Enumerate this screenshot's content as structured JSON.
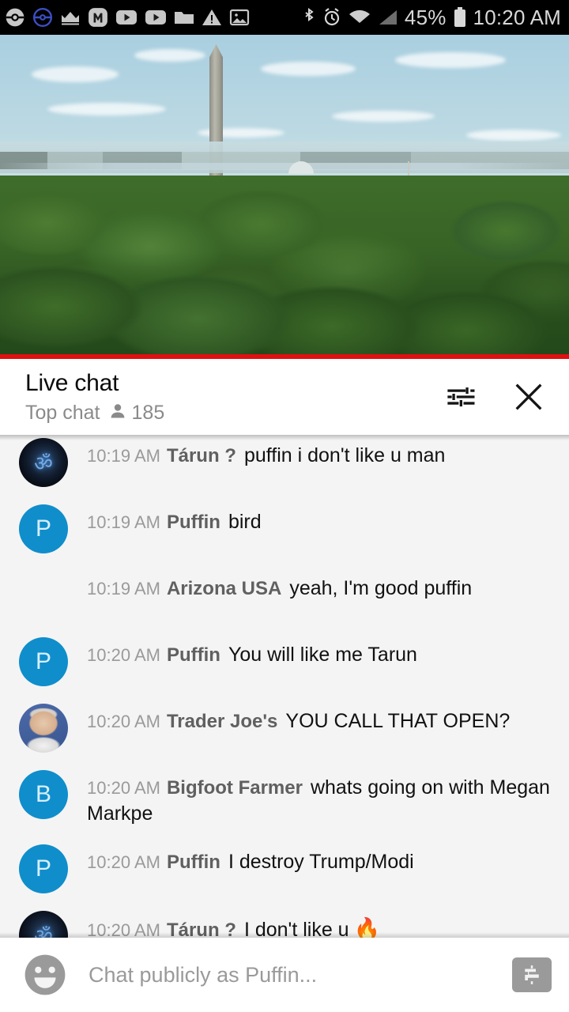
{
  "status_bar": {
    "left_icons": [
      {
        "name": "pokeball-icon",
        "glyph": "pokeball"
      },
      {
        "name": "pokeball-outline-icon",
        "glyph": "pokeball-outline"
      },
      {
        "name": "crown-icon",
        "glyph": "crown"
      },
      {
        "name": "monument-app-icon",
        "glyph": "M"
      },
      {
        "name": "youtube-icon",
        "glyph": "play"
      },
      {
        "name": "youtube-icon-2",
        "glyph": "play"
      },
      {
        "name": "folder-icon",
        "glyph": "folder"
      },
      {
        "name": "warning-icon",
        "glyph": "warning"
      },
      {
        "name": "image-icon",
        "glyph": "image"
      }
    ],
    "right_icons": [
      {
        "name": "bluetooth-icon",
        "glyph": "bluetooth"
      },
      {
        "name": "alarm-icon",
        "glyph": "alarm"
      },
      {
        "name": "wifi-icon",
        "glyph": "wifi"
      },
      {
        "name": "cellular-signal-icon",
        "glyph": "signal"
      }
    ],
    "battery_percent": "45%",
    "time": "10:20 AM"
  },
  "video": {
    "progress_percent": 100,
    "progress_color": "#e01010",
    "live": true
  },
  "chat_header": {
    "title": "Live chat",
    "mode_label": "Top chat",
    "viewer_count": "185",
    "viewer_icon": "person-icon",
    "filter_icon": "tune-sliders-icon",
    "close_icon": "close-icon"
  },
  "messages": [
    {
      "time": "10:19 AM",
      "author": "Tárun ?",
      "text": "puffin i don't like u man",
      "emoji": "",
      "avatar_type": "dark-om",
      "avatar_initial": "ॐ"
    },
    {
      "time": "10:19 AM",
      "author": "Puffin",
      "text": "bird",
      "emoji": "",
      "avatar_type": "blue",
      "avatar_initial": "P"
    },
    {
      "time": "10:19 AM",
      "author": "Arizona USA",
      "text": "yeah, I'm good puffin",
      "emoji": "",
      "avatar_type": "gold-photo",
      "avatar_initial": ""
    },
    {
      "time": "10:20 AM",
      "author": "Puffin",
      "text": "You will like me Tarun",
      "emoji": "",
      "avatar_type": "blue",
      "avatar_initial": "P"
    },
    {
      "time": "10:20 AM",
      "author": "Trader Joe's",
      "text": "YOU CALL THAT OPEN?",
      "emoji": "",
      "avatar_type": "man-photo",
      "avatar_initial": ""
    },
    {
      "time": "10:20 AM",
      "author": "Bigfoot Farmer",
      "text": "whats going on with Megan Markpe",
      "emoji": "",
      "avatar_type": "blue",
      "avatar_initial": "B"
    },
    {
      "time": "10:20 AM",
      "author": "Puffin",
      "text": "I destroy Trump/Modi",
      "emoji": "",
      "avatar_type": "blue",
      "avatar_initial": "P"
    },
    {
      "time": "10:20 AM",
      "author": "Tárun ?",
      "text": "I don't like u",
      "emoji": "🔥",
      "avatar_type": "dark-om",
      "avatar_initial": "ॐ"
    }
  ],
  "chat_input": {
    "emoji_icon": "emoji-smiley-icon",
    "placeholder": "Chat publicly as Puffin...",
    "value": "",
    "superchat_icon": "dollar-superchat-icon"
  },
  "colors": {
    "accent_blue": "#0f8ecb",
    "live_red": "#e01010",
    "chat_bg": "#f4f4f4",
    "muted_text": "#9a9a9a"
  }
}
